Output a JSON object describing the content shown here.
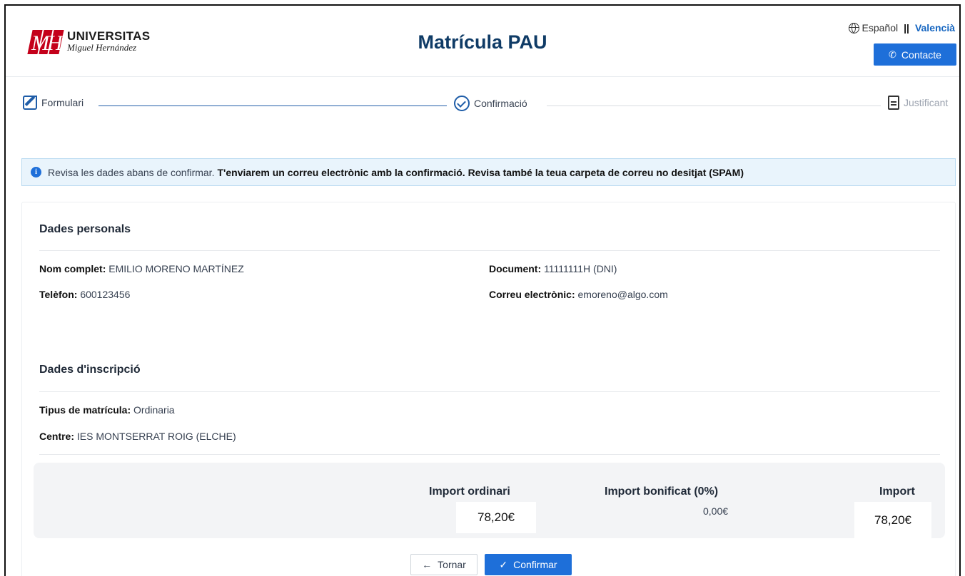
{
  "header": {
    "logo_line1": "UNIVERSITAS",
    "logo_line2": "Miguel Hernández",
    "logo_glyph": "MH",
    "title": "Matrícula PAU",
    "lang_option": "Español",
    "lang_separator": "||",
    "lang_current": "Valencià",
    "contact_label": "Contacte"
  },
  "stepper": {
    "steps": [
      {
        "label": "Formulari",
        "icon": "edit-icon"
      },
      {
        "label": "Confirmació",
        "icon": "check-circle-icon"
      },
      {
        "label": "Justificant",
        "icon": "document-icon"
      }
    ]
  },
  "alert": {
    "text_normal": "Revisa les dades abans de confirmar.",
    "text_bold": "T'enviarem un correu electrònic amb la confirmació. Revisa també la teua carpeta de correu no desitjat (SPAM)"
  },
  "personal": {
    "title": "Dades personals",
    "name_label": "Nom complet",
    "name_value": "EMILIO MORENO MARTÍNEZ",
    "document_label": "Document",
    "document_value": "11111111H (DNI)",
    "phone_label": "Telèfon",
    "phone_value": "600123456",
    "email_label": "Correu electrònic",
    "email_value": "emoreno@algo.com"
  },
  "enrollment": {
    "title": "Dades d'inscripció",
    "type_label": "Tipus de matrícula",
    "type_value": "Ordinaria",
    "centre_label": "Centre",
    "centre_value": "IES MONTSERRAT ROIG (ELCHE)"
  },
  "totals": {
    "ordinary_label": "Import ordinari",
    "ordinary_value": "78,20€",
    "discount_label": "Import bonificat (0%)",
    "discount_value": "0,00€",
    "total_label": "Import",
    "total_value": "78,20€"
  },
  "actions": {
    "back_label": "Tornar",
    "confirm_label": "Confirmar"
  },
  "colors": {
    "primary": "#1e6fd9",
    "title": "#0f3b66",
    "brand_red": "#c4001a"
  }
}
